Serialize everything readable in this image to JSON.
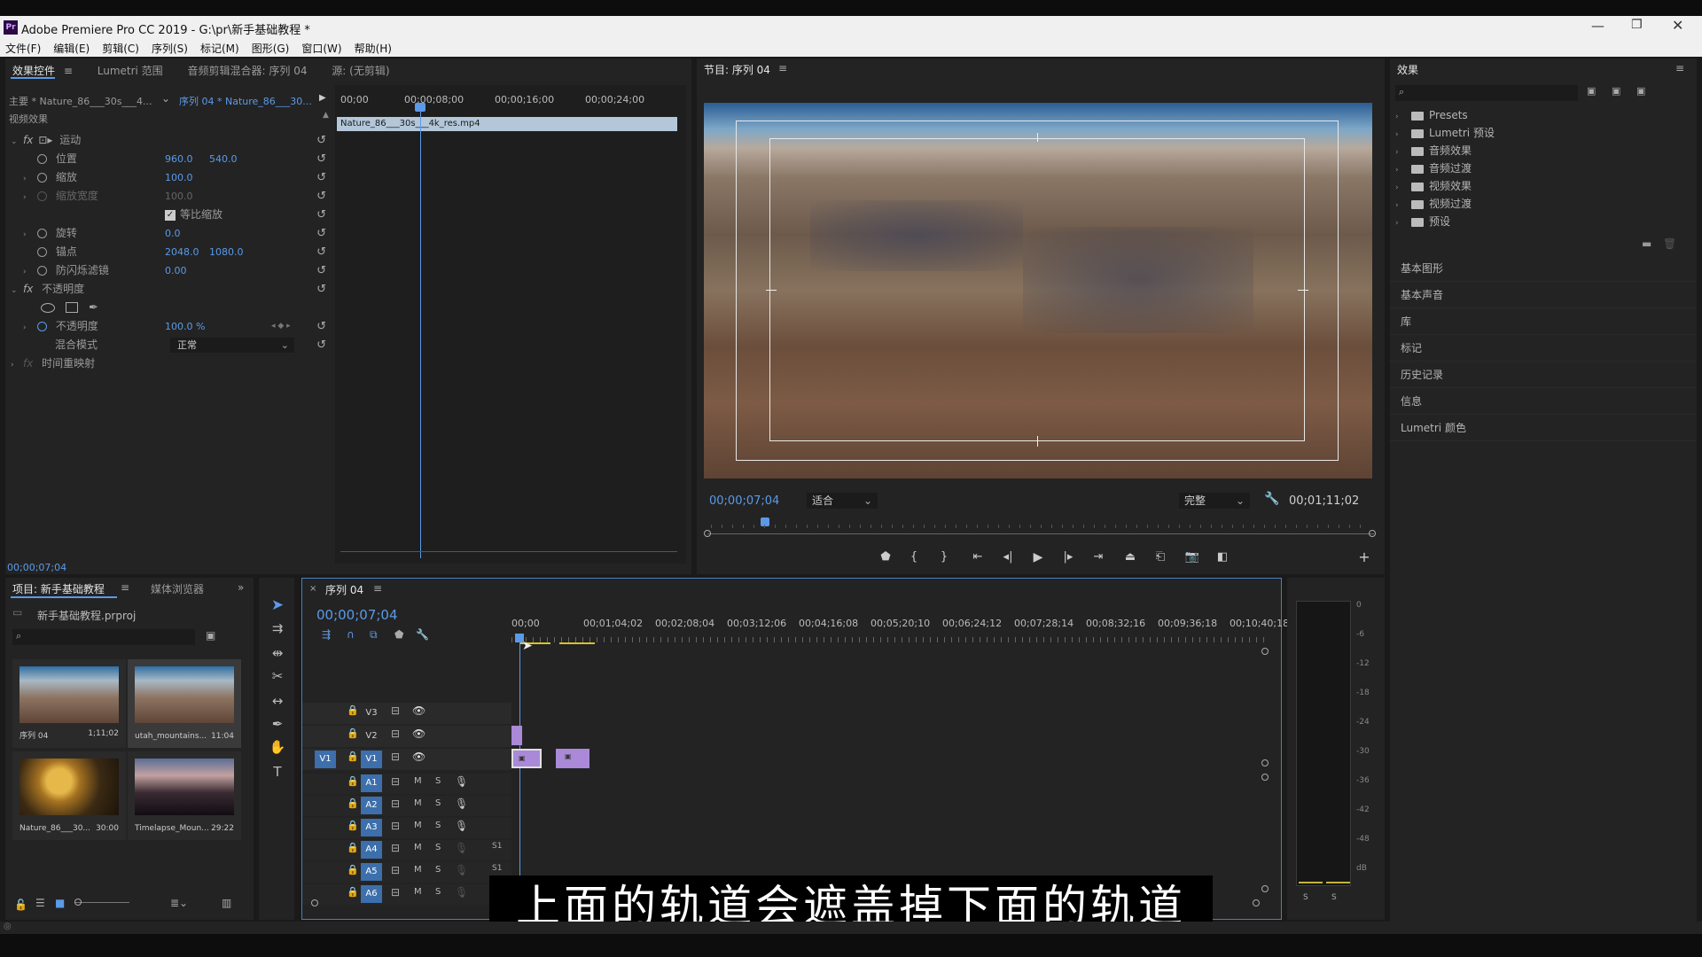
{
  "title_bar": {
    "app_title": "Adobe Premiere Pro CC 2019 - G:\\pr\\新手基础教程 *",
    "logo": "Pr"
  },
  "menu": [
    "文件(F)",
    "编辑(E)",
    "剪辑(C)",
    "序列(S)",
    "标记(M)",
    "图形(G)",
    "窗口(W)",
    "帮助(H)"
  ],
  "left_panel": {
    "tabs": [
      "效果控件",
      "Lumetri 范围",
      "音频剪辑混合器: 序列 04",
      "源: (无剪辑)"
    ],
    "master_clip": "主要 * Nature_86___30s___4...",
    "seq_clip": "序列 04 * Nature_86___30...",
    "ruler": [
      "00;00",
      "00;00;08;00",
      "00;00;16;00",
      "00;00;24;00"
    ],
    "clip_bar": "Nature_86___30s___4k_res.mp4",
    "video_effects": "视频效果",
    "motion": "运动",
    "position": {
      "label": "位置",
      "x": "960.0",
      "y": "540.0"
    },
    "scale": {
      "label": "缩放",
      "value": "100.0"
    },
    "scale_width": {
      "label": "缩放宽度",
      "value": "100.0"
    },
    "uniform": "等比缩放",
    "rotation": {
      "label": "旋转",
      "value": "0.0"
    },
    "anchor": {
      "label": "锚点",
      "x": "2048.0",
      "y": "1080.0"
    },
    "flicker": {
      "label": "防闪烁滤镜",
      "value": "0.00"
    },
    "opacity_group": "不透明度",
    "opacity": {
      "label": "不透明度",
      "value": "100.0 %"
    },
    "blend": {
      "label": "混合模式",
      "value": "正常"
    },
    "time_remap": "时间重映射",
    "timecode": "00;00;07;04"
  },
  "program": {
    "title": "节目: 序列 04",
    "timecode": "00;00;07;04",
    "fit": "适合",
    "quality": "完整",
    "duration": "00;01;11;02"
  },
  "effects_panel": {
    "title": "效果",
    "folders": [
      "Presets",
      "Lumetri 预设",
      "音频效果",
      "音频过渡",
      "视频效果",
      "视频过渡",
      "预设"
    ],
    "panels": [
      "基本图形",
      "基本声音",
      "库",
      "标记",
      "历史记录",
      "信息",
      "Lumetri 颜色"
    ]
  },
  "project": {
    "tabs": [
      "项目: 新手基础教程",
      "媒体浏览器"
    ],
    "file": "新手基础教程.prproj",
    "thumbs": [
      {
        "name": "序列 04",
        "dur": "1;11;02"
      },
      {
        "name": "utah_mountains...",
        "dur": "11:04"
      },
      {
        "name": "Nature_86___30...",
        "dur": "30:00"
      },
      {
        "name": "Timelapse_Moun...",
        "dur": "29:22"
      }
    ]
  },
  "timeline": {
    "tab": "序列 04",
    "timecode": "00;00;07;04",
    "ruler": [
      "00;00",
      "00;01;04;02",
      "00;02;08;04",
      "00;03;12;06",
      "00;04;16;08",
      "00;05;20;10",
      "00;06;24;12",
      "00;07;28;14",
      "00;08;32;16",
      "00;09;36;18",
      "00;10;40;18"
    ],
    "video_tracks": [
      "V3",
      "V2",
      "V1"
    ],
    "audio_tracks": [
      "A1",
      "A2",
      "A3",
      "A4",
      "A5",
      "A6"
    ],
    "src_patch": "V1",
    "m": "M",
    "s": "S",
    "s1": "S1"
  },
  "meter": {
    "scale": [
      "0",
      "-6",
      "-12",
      "-18",
      "-24",
      "-30",
      "-36",
      "-42",
      "-48",
      "dB"
    ],
    "solo": [
      "S",
      "S"
    ]
  },
  "subtitle": "上面的轨道会遮盖掉下面的轨道",
  "colors": {
    "accent": "#5b9ae8",
    "clip_purple": "#a989d8",
    "playhead": "#5b9ae8",
    "bg": "#232323"
  }
}
